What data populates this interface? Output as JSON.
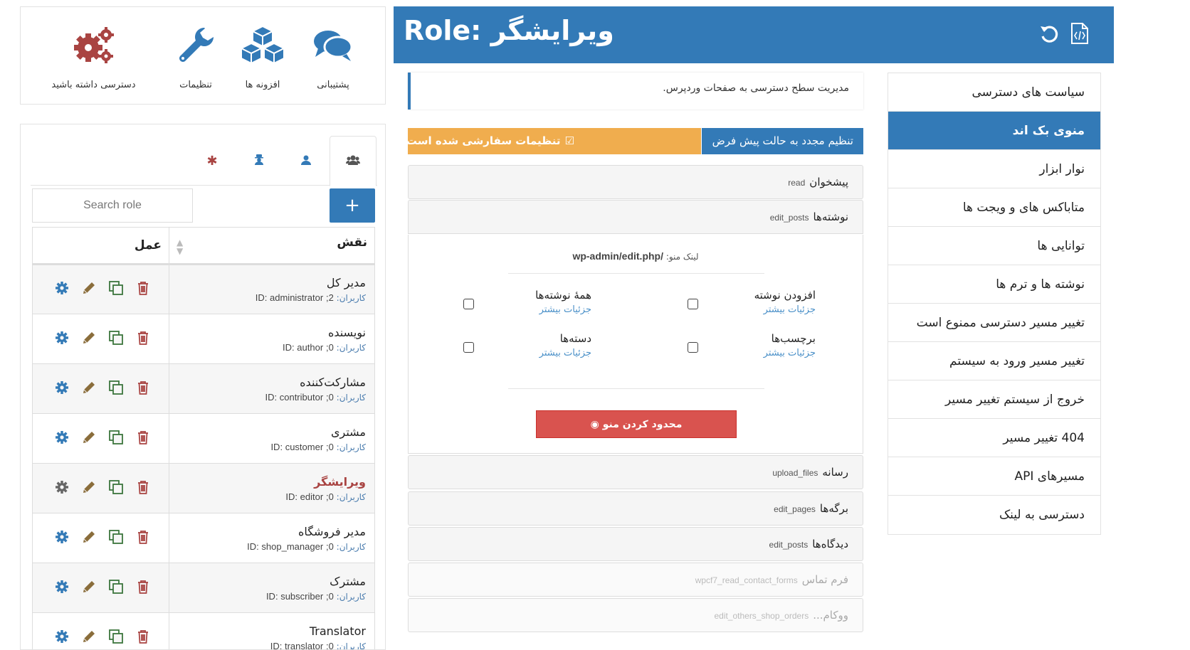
{
  "quick_links": [
    {
      "label": "پشتیبانی",
      "icon": "comments-icon"
    },
    {
      "label": "افزونه ها",
      "icon": "cubes-icon"
    },
    {
      "label": "تنظیمات",
      "icon": "wrench-icon"
    },
    {
      "label": "دسترسی داشته باشید",
      "icon": "gears-icon"
    }
  ],
  "colors": {
    "primary": "#337ab7",
    "warning": "#f0ad4e",
    "danger": "#d9534f",
    "current_role": "#a94442"
  },
  "roles_panel": {
    "search_placeholder": "Search role",
    "add_label": "+",
    "columns": {
      "action": "عمل",
      "role": "نقش"
    },
    "roles": [
      {
        "name": "مدیر کل",
        "users_label": "کاربران:",
        "users": "2",
        "id_label": "ID:",
        "id": "administrator",
        "current": false
      },
      {
        "name": "نویسنده",
        "users_label": "کاربران:",
        "users": "0",
        "id_label": "ID:",
        "id": "author",
        "current": false
      },
      {
        "name": "مشارکت‌کننده",
        "users_label": "کاربران:",
        "users": "0",
        "id_label": "ID:",
        "id": "contributor",
        "current": false
      },
      {
        "name": "مشتری",
        "users_label": "کاربران:",
        "users": "0",
        "id_label": "ID:",
        "id": "customer",
        "current": false
      },
      {
        "name": "ویرایشگر",
        "users_label": "کاربران:",
        "users": "0",
        "id_label": "ID:",
        "id": "editor",
        "current": true
      },
      {
        "name": "مدیر فروشگاه",
        "users_label": "کاربران:",
        "users": "0",
        "id_label": "ID:",
        "id": "shop_manager",
        "current": false
      },
      {
        "name": "مشترک",
        "users_label": "کاربران:",
        "users": "0",
        "id_label": "ID:",
        "id": "subscriber",
        "current": false
      },
      {
        "name": "Translator",
        "users_label": "کاربران:",
        "users": "0",
        "id_label": "ID:",
        "id": "translator",
        "current": false
      }
    ]
  },
  "header": {
    "title": "Role: ویرایشگر"
  },
  "side_menu": [
    {
      "label": "سیاست های دسترسی",
      "active": false
    },
    {
      "label": "منوی بک اند",
      "active": true
    },
    {
      "label": "نوار ابزار",
      "active": false
    },
    {
      "label": "متاباکس های و ویجت ها",
      "active": false
    },
    {
      "label": "توانایی ها",
      "active": false
    },
    {
      "label": "نوشته ها و ترم ها",
      "active": false
    },
    {
      "label": "تغییر مسیر دسترسی ممنوع است",
      "active": false
    },
    {
      "label": "تغییر مسیر ورود به سیستم",
      "active": false
    },
    {
      "label": "خروج از سیستم تغییر مسیر",
      "active": false
    },
    {
      "label": "404 تغییر مسیر",
      "active": false
    },
    {
      "label": "مسیرهای API",
      "active": false
    },
    {
      "label": "دسترسی به لینک",
      "active": false
    }
  ],
  "content": {
    "description": "مدیریت سطح دسترسی به صفحات وردپرس.",
    "customized_label": "تنظیمات سفارشی شده است",
    "reset_label": "تنظیم مجدد به حالت پیش فرض",
    "menus": [
      {
        "title": "پیشخوان",
        "cap": "read",
        "disabled": false
      },
      {
        "title": "نوشته‌ها",
        "cap": "edit_posts",
        "disabled": false
      },
      {
        "title": "رسانه",
        "cap": "upload_files",
        "disabled": false
      },
      {
        "title": "برگه‌ها",
        "cap": "edit_pages",
        "disabled": false
      },
      {
        "title": "دیدگاه‌ها",
        "cap": "edit_posts",
        "disabled": false
      },
      {
        "title": "فرم تماس",
        "cap": "wpcf7_read_contact_forms",
        "disabled": true
      },
      {
        "title": "ووکام...",
        "cap": "edit_others_shop_orders",
        "disabled": true
      }
    ],
    "expanded": {
      "link_label": "لینک منو:",
      "link_value": "/wp-admin/edit.php",
      "submenus": [
        {
          "title": "افزودن نوشته",
          "more": "جزئیات بیشتر"
        },
        {
          "title": "همهٔ نوشته‌ها",
          "more": "جزئیات بیشتر"
        },
        {
          "title": "برچسب‌ها",
          "more": "جزئیات بیشتر"
        },
        {
          "title": "دسته‌ها",
          "more": "جزئیات بیشتر"
        }
      ],
      "restrict_label": "محدود کردن منو"
    }
  }
}
